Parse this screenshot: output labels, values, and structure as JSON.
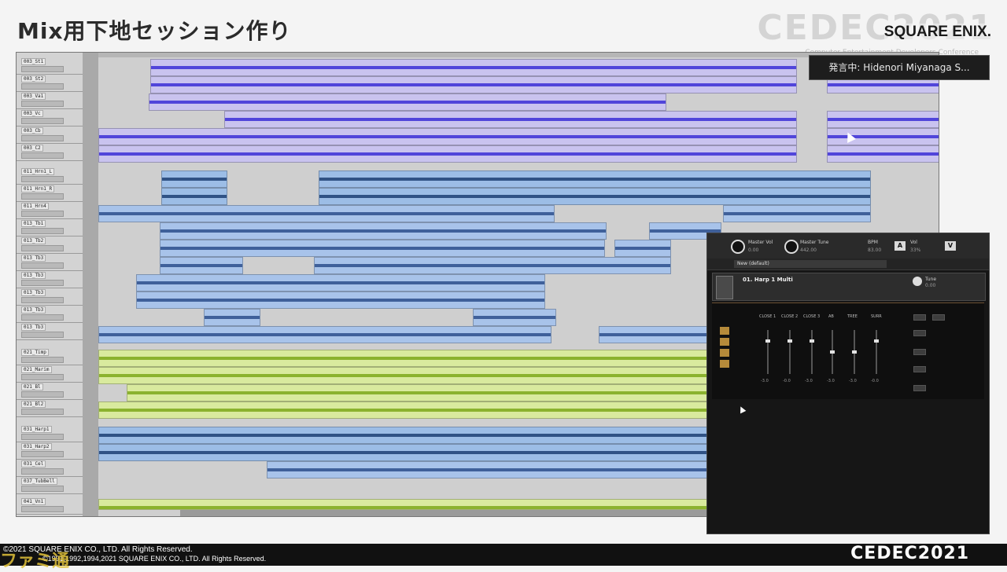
{
  "slide": {
    "title": "Mix用下地セッション作り",
    "brand_cedec": "CEDEC2021",
    "brand_sqex": "SQUARE ENIX.",
    "brand_sub": "Computer Entertainment Developers Conference"
  },
  "speaker": {
    "label": "発言中: Hidenori Miyanaga S..."
  },
  "daw": {
    "tracks": [
      {
        "name": "003_St1"
      },
      {
        "name": "003_St2"
      },
      {
        "name": "003_Va1"
      },
      {
        "name": "003_Vc"
      },
      {
        "name": "003_Cb"
      },
      {
        "name": "003_C2"
      },
      {
        "name": "011_Hrn1_L"
      },
      {
        "name": "011_Hrn1_R"
      },
      {
        "name": "011_Hrn4"
      },
      {
        "name": "013_Tb1"
      },
      {
        "name": "013_Tb2"
      },
      {
        "name": "013_Tb3"
      },
      {
        "name": "013_Tb3"
      },
      {
        "name": "013_Tb3"
      },
      {
        "name": "013_Tb3"
      },
      {
        "name": "013_Tb3"
      },
      {
        "name": "021_Timp"
      },
      {
        "name": "021_Marim"
      },
      {
        "name": "021_Bl"
      },
      {
        "name": "021_Bl2"
      },
      {
        "name": "031_Harp1"
      },
      {
        "name": "031_Harp2"
      },
      {
        "name": "031_Cel"
      },
      {
        "name": "037_TubBell"
      },
      {
        "name": "041_Vn1"
      }
    ]
  },
  "kontakt": {
    "master_vol_label": "Master Vol",
    "master_vol_value": "0.00",
    "master_tune_label": "Master Tune",
    "master_tune_value": "442.00",
    "bpm_label": "BPM",
    "bpm_value": "83.00",
    "vol_label": "Vol",
    "vol_value": "33%",
    "preset": "New (default)",
    "instrument_name": "01. Harp 1 Multi",
    "tune_label": "Tune",
    "tune_value": "0.00",
    "sliders": [
      {
        "label": "CLOSE 1",
        "value": "-3.0"
      },
      {
        "label": "CLOSE 2",
        "value": "-0.0"
      },
      {
        "label": "CLOSE 3",
        "value": "-3.0"
      },
      {
        "label": "AB",
        "value": "-3.0"
      },
      {
        "label": "TREE",
        "value": "-3.0"
      },
      {
        "label": "SURR",
        "value": "-0.0"
      }
    ]
  },
  "footer": {
    "copyright_line1": "©2021 SQUARE ENIX CO., LTD. All Rights Reserved.",
    "copyright_line2": "©1991,1992,1994,2021 SQUARE ENIX CO., LTD. All Rights Reserved.",
    "logo": "CEDEC2021",
    "watermark": "ファミ通"
  }
}
